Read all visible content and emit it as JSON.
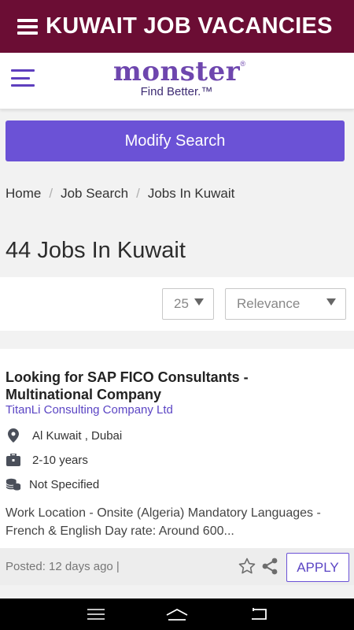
{
  "app_bar": {
    "title": "KUWAIT JOB VACANCIES",
    "menu_icon": "menu-icon",
    "background": "#6b0d34"
  },
  "site_header": {
    "menu_icon": "hamburger-icon",
    "logo": {
      "word": "monster",
      "registered": "®",
      "tagline": "Find Better.™"
    }
  },
  "modify_search": {
    "label": "Modify Search",
    "color": "#6b52d6"
  },
  "breadcrumb": {
    "items": [
      "Home",
      "Job Search",
      "Jobs In Kuwait"
    ],
    "separator": "/"
  },
  "results": {
    "title": "44 Jobs In Kuwait"
  },
  "filters": {
    "per_page": {
      "value": "25"
    },
    "sort": {
      "value": "Relevance"
    }
  },
  "job": {
    "title": "Looking for SAP FICO Consultants - Multinational Company",
    "company": "TitanLi Consulting Company Ltd",
    "location": "Al Kuwait , Dubai",
    "experience": "2-10 years",
    "salary": "Not Specified",
    "description": "Work Location - Onsite (Algeria) Mandatory Languages - French & English Day rate: Around 600...",
    "posted": "Posted: 12 days ago |",
    "apply_label": "APPLY",
    "icons": [
      "location-icon",
      "briefcase-icon",
      "money-icon",
      "star-icon",
      "share-icon"
    ]
  },
  "system_nav": {
    "icons": [
      "recents-icon",
      "home-icon",
      "back-icon"
    ]
  }
}
